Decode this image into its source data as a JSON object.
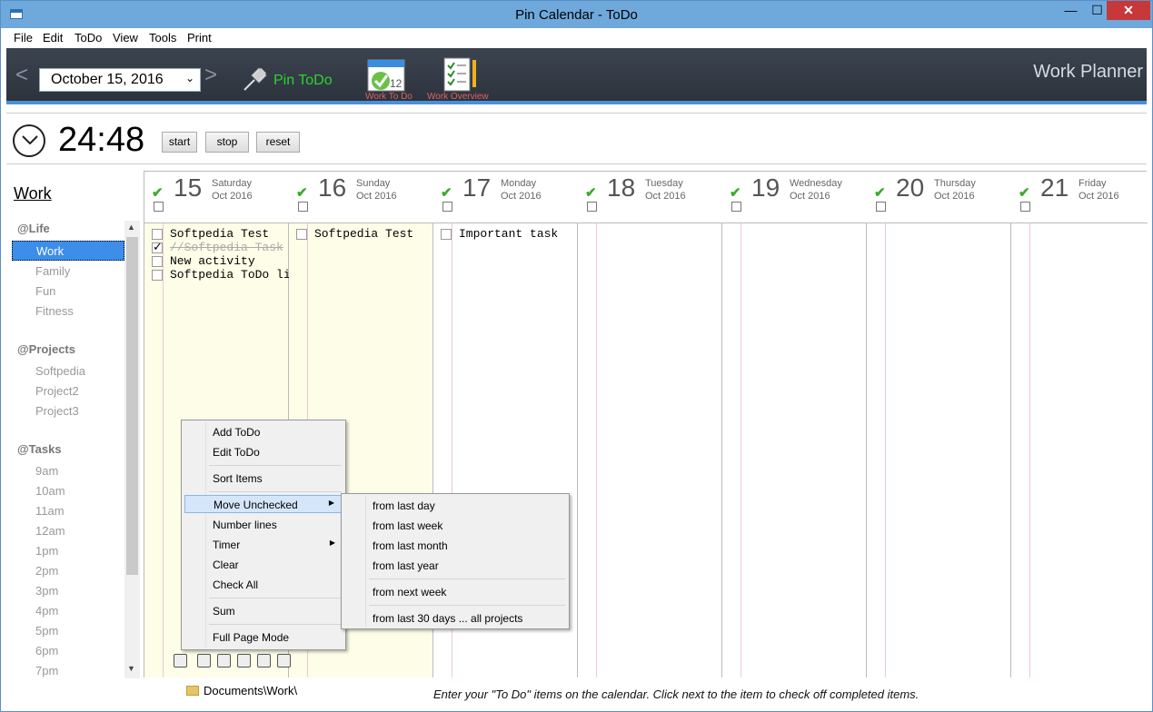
{
  "window": {
    "title": "Pin Calendar - ToDo",
    "min": "—",
    "max": "☐",
    "close": "✕"
  },
  "menubar": [
    "File",
    "Edit",
    "ToDo",
    "View",
    "Tools",
    "Print"
  ],
  "toolbar": {
    "prev": "<",
    "next": ">",
    "date": "October    15, 2016",
    "pin_label": "Pin ToDo",
    "work_todo": "Work To Do",
    "work_overview": "Work Overview",
    "planner_title": "Work Planner"
  },
  "timer": {
    "value": "24:48",
    "start": "start",
    "stop": "stop",
    "reset": "reset"
  },
  "sidebar": {
    "title": "Work",
    "groups": [
      {
        "head": "@Life",
        "items": [
          "Work",
          "Family",
          "Fun",
          "Fitness"
        ]
      },
      {
        "head": "@Projects",
        "items": [
          "Softpedia",
          "Project2",
          "Project3"
        ]
      },
      {
        "head": "@Tasks",
        "items": [
          "9am",
          "10am",
          "11am",
          "12am",
          "1pm",
          "2pm",
          "3pm",
          "4pm",
          "5pm",
          "6pm",
          "7pm"
        ]
      }
    ],
    "selected": "Work"
  },
  "days": [
    {
      "num": "15",
      "name": "Saturday",
      "mon": "Oct 2016",
      "todos": [
        {
          "text": "Softpedia Test",
          "done": false
        },
        {
          "text": "//Softpedia Task",
          "done": true
        },
        {
          "text": "New activity",
          "done": false
        },
        {
          "text": "Softpedia ToDo list",
          "done": false
        }
      ]
    },
    {
      "num": "16",
      "name": "Sunday",
      "mon": "Oct 2016",
      "todos": [
        {
          "text": "Softpedia Test",
          "done": false
        }
      ]
    },
    {
      "num": "17",
      "name": "Monday",
      "mon": "Oct 2016",
      "todos": [
        {
          "text": "Important task",
          "done": false
        }
      ]
    },
    {
      "num": "18",
      "name": "Tuesday",
      "mon": "Oct 2016",
      "todos": []
    },
    {
      "num": "19",
      "name": "Wednesday",
      "mon": "Oct 2016",
      "todos": []
    },
    {
      "num": "20",
      "name": "Thursday",
      "mon": "Oct 2016",
      "todos": []
    },
    {
      "num": "21",
      "name": "Friday",
      "mon": "Oct 2016",
      "todos": []
    }
  ],
  "context_menu": [
    "Add ToDo",
    "Edit ToDo",
    "Sort Items",
    "Move Unchecked",
    "Number lines",
    "Timer",
    "Clear",
    "Check All",
    "Sum",
    "Full Page Mode"
  ],
  "submenu": [
    "from last day",
    "from last week",
    "from last month",
    "from last year",
    "from next week",
    "from last 30 days ... all projects"
  ],
  "footer": {
    "path": "Documents\\Work\\",
    "hint": "Enter your \"To Do\" items on the calendar. Click next to the item to check off completed items."
  }
}
